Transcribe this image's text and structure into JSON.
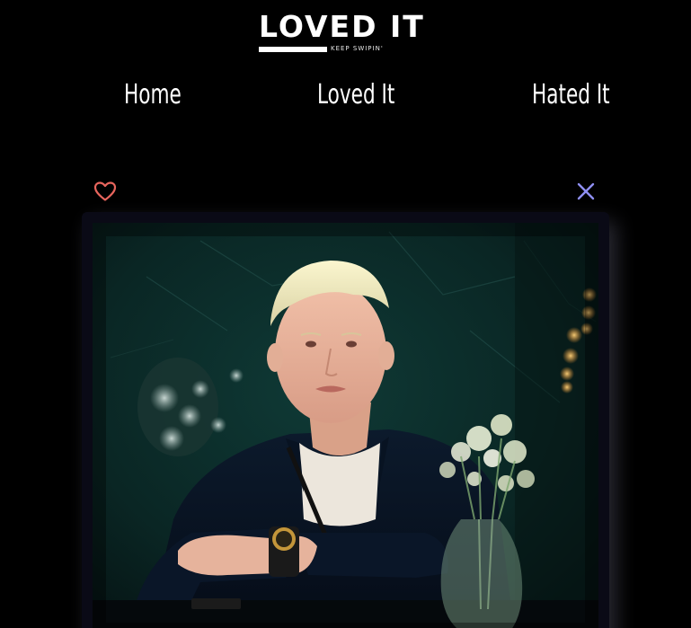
{
  "logo": {
    "title": "LOVED IT",
    "tagline": "KEEP SWIPIN'"
  },
  "nav": {
    "home": "Home",
    "loved": "Loved It",
    "hated": "Hated It"
  },
  "actions": {
    "love_icon": "heart-icon",
    "hate_icon": "close-icon",
    "love_color": "#e8655d",
    "hate_color": "#8f8ff2"
  },
  "card": {
    "background": "#0a0a16"
  }
}
